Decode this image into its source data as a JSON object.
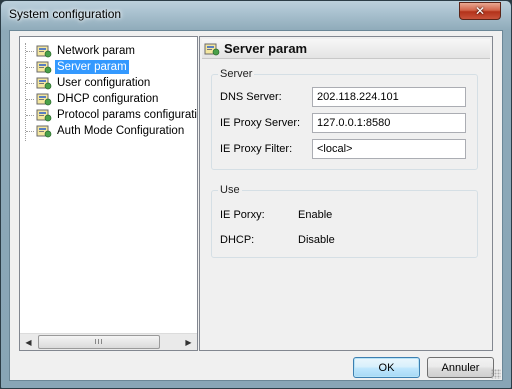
{
  "window": {
    "title": "System configuration",
    "close_icon": "close-icon"
  },
  "tree": {
    "items": [
      {
        "label": "Network param",
        "icon": "config-node-icon",
        "selected": false
      },
      {
        "label": "Server param",
        "icon": "config-node-icon",
        "selected": true
      },
      {
        "label": "User configuration",
        "icon": "config-node-icon",
        "selected": false
      },
      {
        "label": "DHCP configuration",
        "icon": "config-node-icon",
        "selected": false
      },
      {
        "label": "Protocol params configuration",
        "icon": "config-node-icon",
        "selected": false
      },
      {
        "label": "Auth Mode Configuration",
        "icon": "config-node-icon",
        "selected": false
      }
    ],
    "scroll_grip": "III"
  },
  "panel": {
    "title": "Server param",
    "server_group": {
      "label": "Server",
      "fields": [
        {
          "label": "DNS Server:",
          "value": "202.118.224.101"
        },
        {
          "label": "IE Proxy Server:",
          "value": "127.0.0.1:8580"
        },
        {
          "label": "IE Proxy Filter:",
          "value": "<local>"
        }
      ]
    },
    "use_group": {
      "label": "Use",
      "rows": [
        {
          "label": "IE Porxy:",
          "value": "Enable"
        },
        {
          "label": "DHCP:",
          "value": "Disable"
        }
      ]
    }
  },
  "buttons": {
    "ok": "OK",
    "cancel": "Annuler"
  },
  "colors": {
    "selection": "#3399ff",
    "close_button": "#c8523a"
  }
}
